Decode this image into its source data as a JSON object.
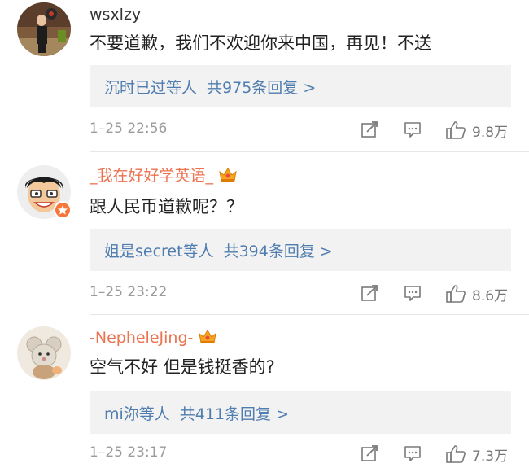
{
  "comments": [
    {
      "username": "wsxlzy",
      "text": "不要道歉，我们不欢迎你来中国，再见！不送",
      "replies_users": "沉时已过等人",
      "replies_count": "共975条回复 >",
      "time": "1–25 22:56",
      "likes": "9.8万"
    },
    {
      "username": "_我在好好学英语_",
      "text": "跟人民币道歉呢？？",
      "replies_users": "姐是secret等人",
      "replies_count": "共394条回复 >",
      "time": "1–25 23:22",
      "likes": "8.6万"
    },
    {
      "username": "-NepheleJing-",
      "text": "空气不好 但是钱挺香的?",
      "replies_users": "mi沵等人",
      "replies_count": "共411条回复 >",
      "time": "1–25 23:17",
      "likes": "7.3万"
    }
  ],
  "icons": {
    "repost": "repost-icon",
    "comment": "comment-icon",
    "like": "thumbs-up-icon",
    "crown": "vip-crown-icon"
  },
  "colors": {
    "link_blue": "#507daf",
    "vip_orange": "#eb7350",
    "reply_bg": "#f2f2f2",
    "meta_gray": "#9b9b9b"
  }
}
